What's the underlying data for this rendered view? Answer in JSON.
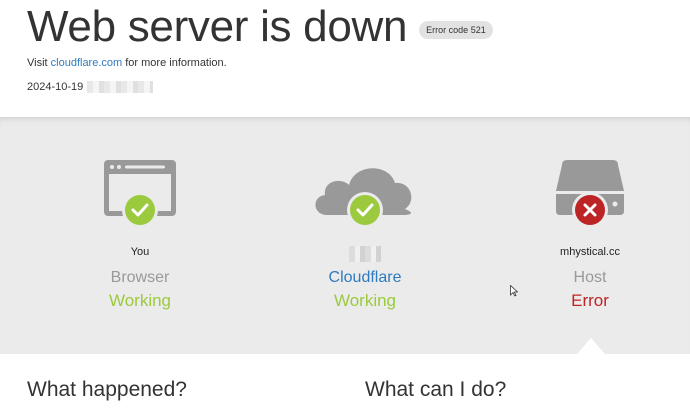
{
  "header": {
    "title": "Web server is down",
    "badge": "Error code 521",
    "visit_prefix": "Visit ",
    "visit_link": "cloudflare.com",
    "visit_suffix": " for more information.",
    "date": "2024-10-19"
  },
  "status": {
    "browser": {
      "who": "You",
      "role": "Browser",
      "state": "Working",
      "icon": "browser-window-icon"
    },
    "cloudflare": {
      "role": "Cloudflare",
      "state": "Working",
      "icon": "cloud-icon"
    },
    "host": {
      "who": "mhystical.cc",
      "role": "Host",
      "state": "Error",
      "icon": "server-drive-icon"
    }
  },
  "sections": {
    "what_happened": "What happened?",
    "what_can_i_do": "What can I do?"
  },
  "colors": {
    "ok": "#9bca3e",
    "error": "#bd2426",
    "link": "#2f7bbf",
    "icon_gray": "#999999"
  }
}
